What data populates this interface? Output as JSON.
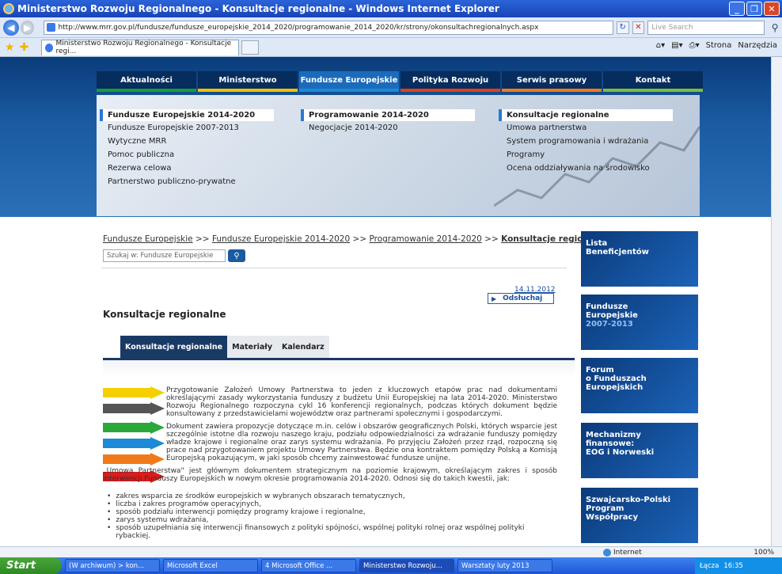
{
  "window": {
    "title": "Ministerstwo Rozwoju Regionalnego - Konsultacje regionalne - Windows Internet Explorer"
  },
  "addressbar": {
    "url": "http://www.mrr.gov.pl/fundusze/fundusze_europejskie_2014_2020/programowanie_2014_2020/kr/strony/okonsultachregionalnych.aspx",
    "search_placeholder": "Live Search"
  },
  "tabbar": {
    "tab_title": "Ministerstwo Rozwoju Regionalnego - Konsultacje regi...",
    "tools": [
      "Strona",
      "Narzędzia"
    ]
  },
  "site": {
    "nav": [
      {
        "label": "Aktualności",
        "color": "#1a9a3a"
      },
      {
        "label": "Ministerstwo",
        "color": "#f0c000"
      },
      {
        "label": "Fundusze Europejskie",
        "color": "#1c8ad6"
      },
      {
        "label": "Polityka Rozwoju",
        "color": "#e0401a"
      },
      {
        "label": "Serwis prasowy",
        "color": "#f07a1a"
      },
      {
        "label": "Kontakt",
        "color": "#7ac03a"
      }
    ],
    "submenu": {
      "col1_head": "Fundusze Europejskie 2014-2020",
      "col1_links": [
        "Fundusze Europejskie 2007-2013",
        "Wytyczne MRR",
        "Pomoc publiczna",
        "Rezerwa celowa",
        "Partnerstwo publiczno-prywatne"
      ],
      "col2_head": "Programowanie 2014-2020",
      "col2_links": [
        "Negocjacje 2014-2020"
      ],
      "col3_head": "Konsultacje regionalne",
      "col3_links": [
        "Umowa partnerstwa",
        "System programowania i wdrażania",
        "Programy",
        "Ocena oddziaływania na środowisko"
      ]
    },
    "breadcrumb": {
      "a": "Fundusze Europejskie",
      "b": "Fundusze Europejskie 2014-2020",
      "c": "Programowanie 2014-2020",
      "current": "Konsultacje regionalne",
      "sep": ">>"
    },
    "search_placeholder": "Szukaj w: Fundusze Europejskie",
    "date": "14.11.2012",
    "listen": "Odsłuchaj",
    "page_title": "Konsultacje regionalne",
    "tabs": [
      "Konsultacje regionalne",
      "Materiały",
      "Kalendarz"
    ],
    "para1": "Przygotowanie Założeń Umowy Partnerstwa to jeden z kluczowych etapów prac nad dokumentami określającymi zasady wykorzystania funduszy z budżetu Unii Europejskiej na lata 2014-2020. Ministerstwo Rozwoju Regionalnego rozpoczyna cykl 16 konferencji regionalnych, podczas których dokument będzie konsultowany z przedstawicielami województw oraz partnerami społecznymi i gospodarczymi.",
    "para2": "Dokument zawiera propozycje dotyczące m.in. celów i obszarów geograficznych Polski, których wsparcie jest szczególnie istotne dla rozwoju naszego kraju, podziału odpowiedzialności za wdrażanie funduszy pomiędzy władze krajowe i regionalne oraz zarys systemu wdrażania. Po przyjęciu Założeń przez rząd, rozpoczną się prace nad przygotowaniem projektu Umowy Partnerstwa. Będzie ona kontraktem pomiędzy Polską a Komisją Europejską pokazującym, w jaki sposób chcemy zainwestować fundusze unijne.",
    "para3": "„Umowa Partnerstwa\" jest głównym dokumentem strategicznym na poziomie krajowym, określającym zakres i sposób interwencji Funduszy Europejskich w nowym okresie programowania 2014-2020. Odnosi się do takich kwestii, jak:",
    "bullets": [
      "zakres wsparcia ze środków europejskich w wybranych obszarach tematycznych,",
      "liczba i zakres programów operacyjnych,",
      "sposób podziału interwencji pomiędzy programy krajowe i regionalne,",
      "zarys systemu wdrażania,",
      "sposób uzupełniania się interwencji finansowych z polityki spójności, wspólnej polityki rolnej oraz wspólnej polityki rybackiej."
    ],
    "arrow_colors": [
      "#f4d000",
      "#555555",
      "#2aa83a",
      "#1c8ad6",
      "#f07a1a",
      "#e01a1a"
    ],
    "banners": [
      {
        "line1": "Lista",
        "line2": "Beneficjentów",
        "line3": ""
      },
      {
        "line1": "Fundusze",
        "line2": "Europejskie",
        "line3": "2007-2013"
      },
      {
        "line1": "Forum",
        "line2": "o Funduszach",
        "line3": "Europejskich"
      },
      {
        "line1": "Mechanizmy",
        "line2": "finansowe:",
        "line3": "EOG i Norweski"
      },
      {
        "line1": "Szwajcarsko-Polski",
        "line2": "Program",
        "line3": "Współpracy"
      }
    ]
  },
  "statusbar": {
    "zone": "Internet",
    "zoom": "100%"
  },
  "taskbar": {
    "start": "Start",
    "items": [
      "(W archiwum) > kon...",
      "Microsoft Excel",
      "4 Microsoft Office ...",
      "Ministerstwo Rozwoju...",
      "Warsztaty luty 2013"
    ],
    "tray_text": "Łącza",
    "clock": "16:35"
  }
}
